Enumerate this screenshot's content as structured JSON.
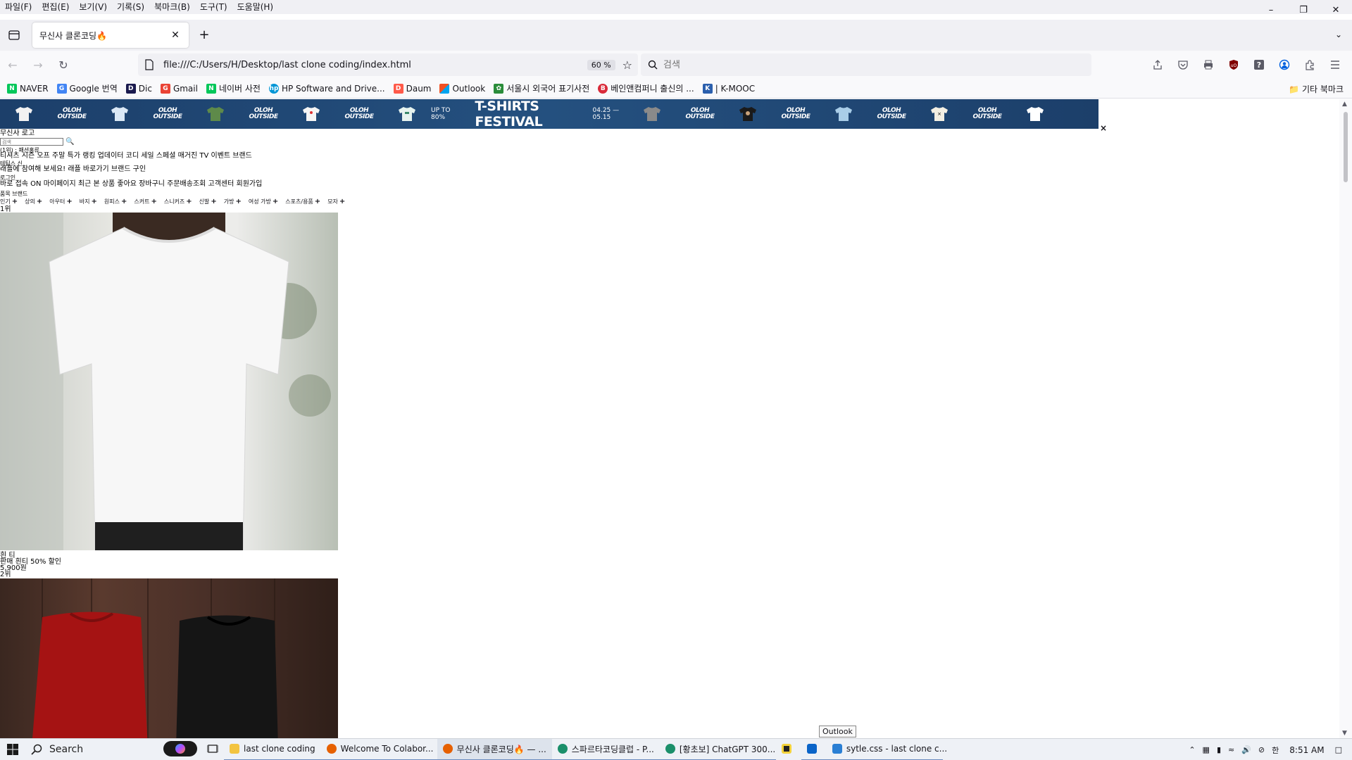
{
  "menubar": {
    "items": [
      "파일(F)",
      "편집(E)",
      "보기(V)",
      "기록(S)",
      "북마크(B)",
      "도구(T)",
      "도움말(H)"
    ]
  },
  "tab": {
    "title": "무신사 클론코딩🔥"
  },
  "navbar": {
    "url": "file:///C:/Users/H/Desktop/last clone coding/index.html",
    "zoom": "60 %",
    "search_placeholder": "검색"
  },
  "bookmarks": {
    "items": [
      {
        "label": "NAVER",
        "color": "#03c75a",
        "glyph": "N"
      },
      {
        "label": "Google 번역",
        "color": "#4285f4",
        "glyph": "G"
      },
      {
        "label": "Dic",
        "color": "#1a1a4e",
        "glyph": "D"
      },
      {
        "label": "Gmail",
        "color": "#ea4335",
        "glyph": "G"
      },
      {
        "label": "네이버 사전",
        "color": "#03c75a",
        "glyph": "N"
      },
      {
        "label": "HP Software and Drive...",
        "color": "#0096d6",
        "glyph": "hp"
      },
      {
        "label": "Daum",
        "color": "#ff5a4a",
        "glyph": "D"
      },
      {
        "label": "Outlook",
        "color": "#f25022",
        "glyph": "■"
      },
      {
        "label": "서울시 외국어 표기사전",
        "color": "#2a8c3a",
        "glyph": "✿"
      },
      {
        "label": "베인앤컴퍼니 출신의 ...",
        "color": "#d92b3a",
        "glyph": "B"
      },
      {
        "label": "| K-MOOC",
        "color": "#2b5fad",
        "glyph": "K"
      }
    ],
    "other": "기타 북마크"
  },
  "banner": {
    "up_to": "UP TO 80%",
    "festival": "T-SHIRTS FESTIVAL",
    "dates": "04.25 — 05.15",
    "brand_logo": "OLOH OUTSIDE",
    "close": "×"
  },
  "page": {
    "logo_text": "무신사 로고",
    "search_placeholder": "검색",
    "search_icon": "🔍",
    "ranking_line": "(1위) : 패션홍류",
    "nav_line": "티셔츠 시즌 오프 주말 특가 랭킹 업데이터 코디 세일 스페셜 매거진 TV 이벤트 브랜드",
    "sub_line": "테팀스 신",
    "promo_line": "래플에 참여해 보세요! 래플 바로가기 브랜드 구인",
    "login": "로그인",
    "member_line": "바로 접속 ON 마이페이지 최근 본 상품 좋아요 장바구니 주문배송조회 고객센터 회원가입",
    "tabs_line": "품목  브랜드",
    "categories": [
      "인기",
      "상의",
      "아우터",
      "바지",
      "원피스",
      "스커트",
      "스니커즈",
      "신발",
      "가방",
      "여성 가방",
      "스포츠/용품",
      "모자"
    ],
    "rank1": "1위",
    "product1_name": "흰 티",
    "product1_desc": "판매 흰티 50% 할인",
    "product1_price": "5,900원",
    "rank2": "2위"
  },
  "taskbar": {
    "search": "Search",
    "apps": [
      {
        "label": "last clone coding",
        "color": "#f3c440"
      },
      {
        "label": "Welcome To Colabor...",
        "color": "#e66000"
      },
      {
        "label": "무신사 클론코딩🔥 — ...",
        "color": "#e66000"
      },
      {
        "label": "스파르타코딩클럽 - P...",
        "color": "#1b8f6a"
      },
      {
        "label": "[황초보] ChatGPT 300...",
        "color": "#1b8f6a"
      }
    ],
    "code_app": "sytle.css - last clone c...",
    "clock": "8:51 AM",
    "ime": "한",
    "tooltip": "Outlook"
  }
}
